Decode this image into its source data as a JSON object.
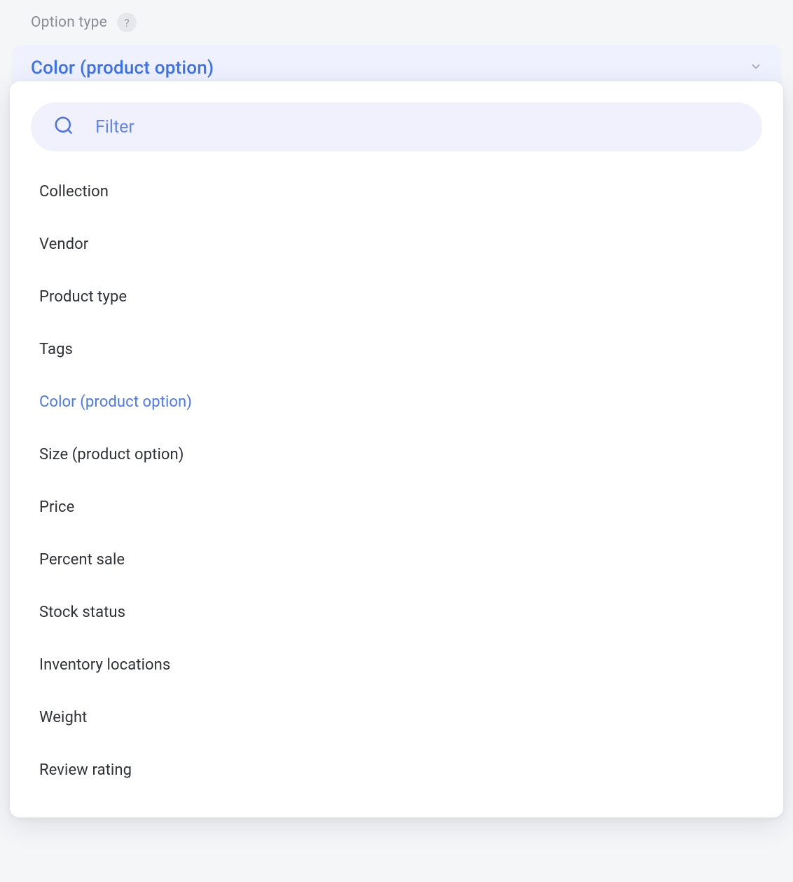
{
  "field": {
    "label": "Option type",
    "help_symbol": "?"
  },
  "select": {
    "value": "Color (product option)"
  },
  "dropdown": {
    "filter_placeholder": "Filter",
    "options": [
      {
        "label": "Collection",
        "selected": false
      },
      {
        "label": "Vendor",
        "selected": false
      },
      {
        "label": "Product type",
        "selected": false
      },
      {
        "label": "Tags",
        "selected": false
      },
      {
        "label": "Color (product option)",
        "selected": true
      },
      {
        "label": "Size (product option)",
        "selected": false
      },
      {
        "label": "Price",
        "selected": false
      },
      {
        "label": "Percent sale",
        "selected": false
      },
      {
        "label": "Stock status",
        "selected": false
      },
      {
        "label": "Inventory locations",
        "selected": false
      },
      {
        "label": "Weight",
        "selected": false
      },
      {
        "label": "Review rating",
        "selected": false
      }
    ]
  }
}
